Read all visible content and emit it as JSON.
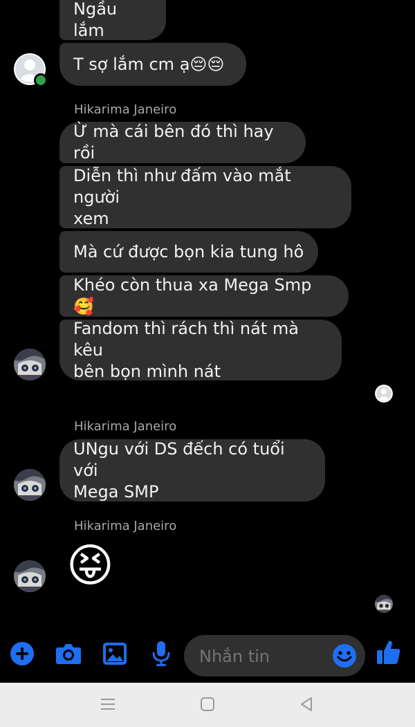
{
  "messages": {
    "m1": "Ngầu lắm",
    "m2": "T sợ lắm cm ạ😔😔",
    "sender1": "Hikarima Janeiro",
    "m3": "Ừ mà cái bên đó thì hay rồi",
    "m4_line1": "Diễn thì như đấm vào mắt người",
    "m4_line2": "xem",
    "m5": "Mà cứ được bọn kia tung hô",
    "m6": "Khéo còn thua xa Mega Smp 🥰",
    "m7_line1": "Fandom thì rách thì nát mà kêu",
    "m7_line2": "bên bọn mình nát",
    "sender2": "Hikarima Janeiro",
    "m8_line1": "UNgu với DS đếch có tuổi với",
    "m8_line2": "Mega SMP",
    "sender3": "Hikarima Janeiro",
    "m9_emoji": "😝"
  },
  "composer": {
    "placeholder": "Nhắn tin"
  },
  "icons": {
    "add": "plus-circle-icon",
    "camera": "camera-icon",
    "gallery": "image-icon",
    "mic": "microphone-icon",
    "emoji": "smiley-icon",
    "like": "thumbs-up-icon"
  },
  "colors": {
    "accent": "#1e6ff1",
    "bubble": "#303030",
    "online": "#31a24c"
  }
}
